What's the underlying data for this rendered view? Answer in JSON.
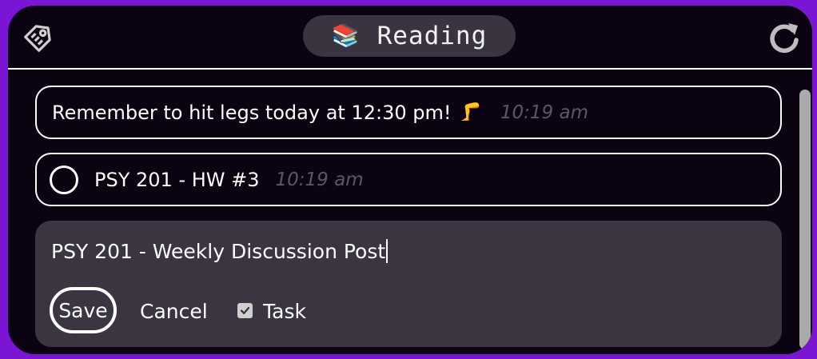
{
  "header": {
    "title_emoji": "📚",
    "title": "Reading"
  },
  "entries": {
    "note": {
      "text": "Remember to hit legs today at 12:30 pm!",
      "emoji": "🦵",
      "time": "10:19 am"
    },
    "task": {
      "text": "PSY 201 - HW #3",
      "time": "10:19 am",
      "completed": false
    }
  },
  "editor": {
    "input_value": "PSY 201 - Weekly Discussion Post",
    "save_label": "Save",
    "cancel_label": "Cancel",
    "task_label": "Task",
    "task_checked": true
  },
  "icons": {
    "left": "tag-icon",
    "right": "refresh-icon"
  },
  "colors": {
    "frame": "#7a16d3",
    "background": "#0c0312",
    "pill": "#3a3441",
    "editor": "#3b3441",
    "timestamp": "#5c5663"
  }
}
